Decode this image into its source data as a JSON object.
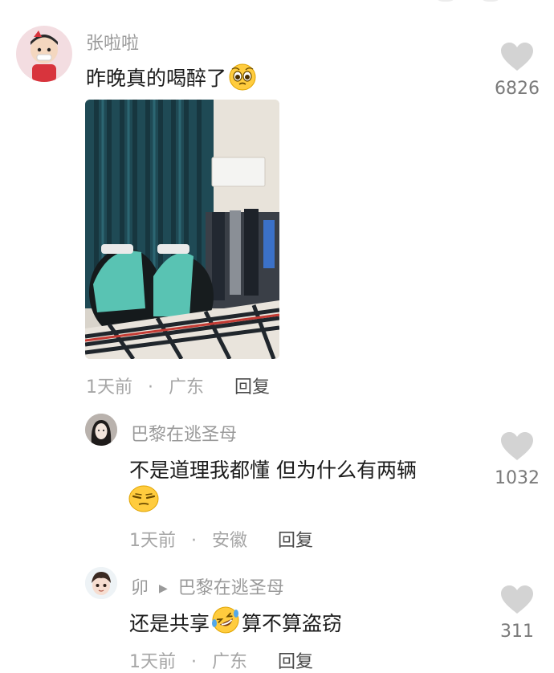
{
  "comments": [
    {
      "user": "张啦啦",
      "text": "昨晚真的喝醉了",
      "time": "1天前",
      "location": "广东",
      "reply_label": "回复",
      "likes": "6826"
    },
    {
      "user": "巴黎在逃圣母",
      "text_line1": "不是道理我都懂 但为什么有两辆",
      "time": "1天前",
      "location": "安徽",
      "reply_label": "回复",
      "likes": "1032"
    },
    {
      "user": "卯",
      "reply_to": "巴黎在逃圣母",
      "text_a": "还是共享",
      "text_b": "算不算盗窃",
      "time": "1天前",
      "location": "广东",
      "reply_label": "回复",
      "likes": "311"
    }
  ],
  "separator": "·",
  "reply_arrow": "▶",
  "colors": {
    "heart": "#d3d3d3",
    "meta": "#a6a6a6",
    "name": "#9a9a9a"
  },
  "icons": [
    "heart-icon",
    "pleading-emoji",
    "smirk-emoji",
    "rofl-emoji",
    "reply-arrow-icon"
  ]
}
